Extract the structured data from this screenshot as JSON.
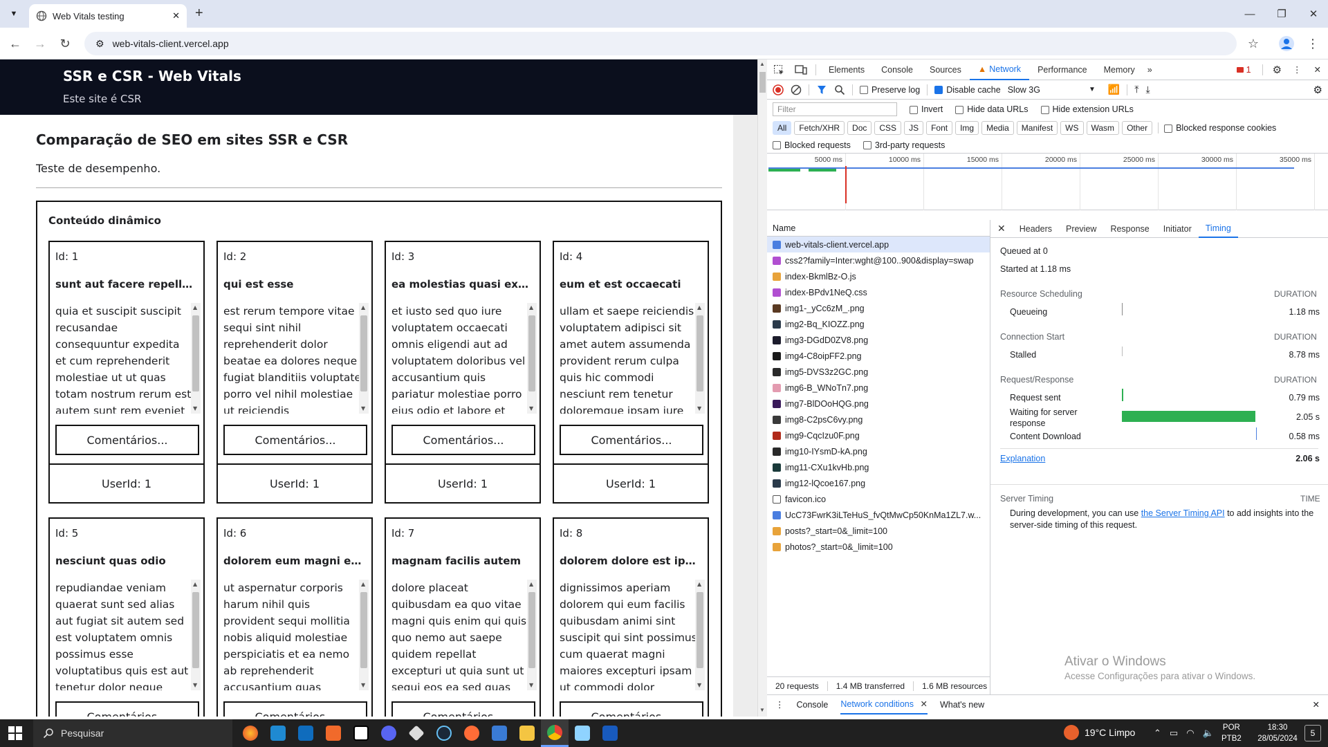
{
  "browser": {
    "tab_title": "Web Vitals testing",
    "url": "web-vitals-client.vercel.app"
  },
  "page": {
    "header_title": "SSR e CSR - Web Vitals",
    "header_subtitle": "Este site é CSR",
    "main_title": "Comparação de SEO em sites SSR e CSR",
    "main_desc": "Teste de desempenho.",
    "section_title": "Conteúdo dinâmico",
    "comments_label": "Comentários...",
    "cards": [
      {
        "id": "Id: 1",
        "title": "sunt aut facere repellat provident occaecati",
        "body": "quia et suscipit suscipit recusandae consequuntur expedita et cum reprehenderit molestiae ut ut quas totam nostrum rerum est autem sunt rem eveniet",
        "user": "UserId: 1"
      },
      {
        "id": "Id: 2",
        "title": "qui est esse",
        "body": "est rerum tempore vitae sequi sint nihil reprehenderit dolor beatae ea dolores neque fugiat blanditiis voluptate porro vel nihil molestiae ut reiciendis",
        "user": "UserId: 1"
      },
      {
        "id": "Id: 3",
        "title": "ea molestias quasi exercitationem",
        "body": "et iusto sed quo iure voluptatem occaecati omnis eligendi aut ad voluptatem doloribus vel accusantium quis pariatur molestiae porro eius odio et labore et",
        "user": "UserId: 1"
      },
      {
        "id": "Id: 4",
        "title": "eum et est occaecati",
        "body": "ullam et saepe reiciendis voluptatem adipisci sit amet autem assumenda provident rerum culpa quis hic commodi nesciunt rem tenetur doloremque ipsam iure",
        "user": "UserId: 1"
      },
      {
        "id": "Id: 5",
        "title": "nesciunt quas odio",
        "body": "repudiandae veniam quaerat sunt sed alias aut fugiat sit autem sed est voluptatem omnis possimus esse voluptatibus quis est aut tenetur dolor neque",
        "user": ""
      },
      {
        "id": "Id: 6",
        "title": "dolorem eum magni eos aperiam quia",
        "body": "ut aspernatur corporis harum nihil quis provident sequi mollitia nobis aliquid molestiae perspiciatis et ea nemo ab reprehenderit accusantium quas",
        "user": ""
      },
      {
        "id": "Id: 7",
        "title": "magnam facilis autem",
        "body": "dolore placeat quibusdam ea quo vitae magni quis enim qui quis quo nemo aut saepe quidem repellat excepturi ut quia sunt ut sequi eos ea sed quas",
        "user": ""
      },
      {
        "id": "Id: 8",
        "title": "dolorem dolore est ipsam",
        "body": "dignissimos aperiam dolorem qui eum facilis quibusdam animi sint suscipit qui sint possimus cum quaerat magni maiores excepturi ipsam ut commodi dolor",
        "user": ""
      }
    ]
  },
  "devtools": {
    "tabs": [
      "Elements",
      "Console",
      "Sources",
      "Network",
      "Performance",
      "Memory"
    ],
    "issues_count": "1",
    "preserve_log": "Preserve log",
    "disable_cache": "Disable cache",
    "throttling": "Slow 3G",
    "filter_placeholder": "Filter",
    "invert": "Invert",
    "hide_data_urls": "Hide data URLs",
    "hide_ext_urls": "Hide extension URLs",
    "type_filters": [
      "All",
      "Fetch/XHR",
      "Doc",
      "CSS",
      "JS",
      "Font",
      "Img",
      "Media",
      "Manifest",
      "WS",
      "Wasm",
      "Other"
    ],
    "blocked_cookies": "Blocked response cookies",
    "blocked_requests": "Blocked requests",
    "third_party": "3rd-party requests",
    "timeline_ticks": [
      "5000 ms",
      "10000 ms",
      "15000 ms",
      "20000 ms",
      "25000 ms",
      "30000 ms",
      "35000 ms"
    ],
    "name_col": "Name",
    "requests": [
      {
        "name": "web-vitals-client.vercel.app",
        "color": "#4a7ee0"
      },
      {
        "name": "css2?family=Inter:wght@100..900&display=swap",
        "color": "#b14fd1"
      },
      {
        "name": "index-BkmlBz-O.js",
        "color": "#e8a33a"
      },
      {
        "name": "index-BPdv1NeQ.css",
        "color": "#b14fd1"
      },
      {
        "name": "img1-_yCc6zM_.png",
        "color": "#5a3a22"
      },
      {
        "name": "img2-Bq_KIOZZ.png",
        "color": "#2b3a4a"
      },
      {
        "name": "img3-DGdD0ZV8.png",
        "color": "#1c1c2c"
      },
      {
        "name": "img4-C8oipFF2.png",
        "color": "#1a1a1a"
      },
      {
        "name": "img5-DVS3z2GC.png",
        "color": "#2a2a2a"
      },
      {
        "name": "img6-B_WNoTn7.png",
        "color": "#e39bb0"
      },
      {
        "name": "img7-BlDOoHQG.png",
        "color": "#3a1a5a"
      },
      {
        "name": "img8-C2psC6vy.png",
        "color": "#3a3a3a"
      },
      {
        "name": "img9-CqcIzu0F.png",
        "color": "#b02a1a"
      },
      {
        "name": "img10-IYsmD-kA.png",
        "color": "#2a2a2a"
      },
      {
        "name": "img11-CXu1kvHb.png",
        "color": "#1a3a3a"
      },
      {
        "name": "img12-lQcoe167.png",
        "color": "#2a3a4a"
      },
      {
        "name": "favicon.ico",
        "color": "#ffffff"
      },
      {
        "name": "UcC73FwrK3iLTeHuS_fvQtMwCp50KnMa1ZL7.w...",
        "color": "#4a7ee0"
      },
      {
        "name": "posts?_start=0&_limit=100",
        "color": "#e8a33a"
      },
      {
        "name": "photos?_start=0&_limit=100",
        "color": "#e8a33a"
      }
    ],
    "status": {
      "requests": "20 requests",
      "transferred": "1.4 MB transferred",
      "resources": "1.6 MB resources"
    },
    "detail_tabs": [
      "Headers",
      "Preview",
      "Response",
      "Initiator",
      "Timing"
    ],
    "timing": {
      "queued": "Queued at 0",
      "started": "Started at 1.18 ms",
      "sec_sched": "Resource Scheduling",
      "sec_conn": "Connection Start",
      "sec_req": "Request/Response",
      "duration": "DURATION",
      "queueing": "Queueing",
      "queueing_v": "1.18 ms",
      "stalled": "Stalled",
      "stalled_v": "8.78 ms",
      "request_sent": "Request sent",
      "request_sent_v": "0.79 ms",
      "waiting": "Waiting for server response",
      "waiting_v": "2.05 s",
      "download": "Content Download",
      "download_v": "0.58 ms",
      "explanation": "Explanation",
      "total": "2.06 s",
      "server_timing": "Server Timing",
      "time": "TIME",
      "server_text_a": "During development, you can use ",
      "server_link": "the Server Timing API",
      "server_text_b": " to add insights into the server-side timing of this request."
    },
    "drawer_tabs": [
      "Console",
      "Network conditions",
      "What's new"
    ]
  },
  "watermark": {
    "title": "Ativar o Windows",
    "sub": "Acesse Configurações para ativar o Windows."
  },
  "taskbar": {
    "search": "Pesquisar",
    "weather": "19°C  Limpo",
    "lang1": "POR",
    "lang2": "PTB2",
    "time": "18:30",
    "date": "28/05/2024",
    "badge": "5"
  }
}
